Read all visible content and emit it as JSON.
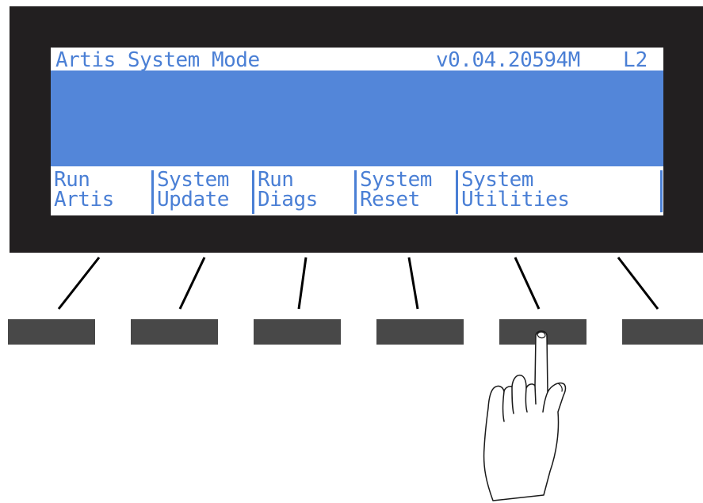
{
  "display": {
    "title": "Artis System Mode",
    "version": "v0.04.20594M",
    "layer": "L2"
  },
  "softkeys": [
    {
      "line1": "Run",
      "line2": "Artis"
    },
    {
      "line1": "System",
      "line2": "Update"
    },
    {
      "line1": "Run",
      "line2": "Diags"
    },
    {
      "line1": "System",
      "line2": "Reset"
    },
    {
      "line1": "System",
      "line2": "Utilities"
    }
  ],
  "colors": {
    "bezel": "#221f20",
    "lcd_text": "#4a7fd5",
    "lcd_highlight": "#5386d9",
    "button": "#484848"
  },
  "pressed_button": 5,
  "icons": [
    "pointing-hand-icon"
  ]
}
